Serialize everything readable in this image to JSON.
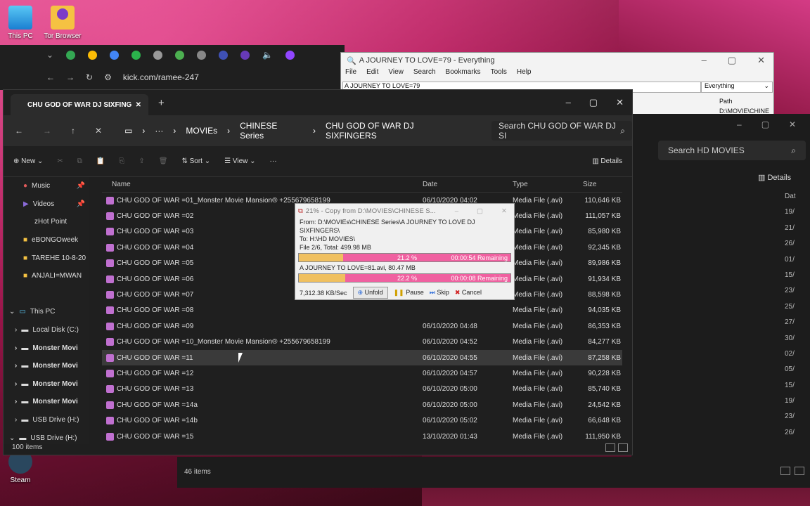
{
  "desktop": {
    "icons": [
      {
        "label": "This PC"
      },
      {
        "label": "Tor Browser"
      },
      {
        "label": "Steam"
      }
    ]
  },
  "browser": {
    "url": "kick.com/ramee-247"
  },
  "everything": {
    "title": "A JOURNEY TO LOVE=79 - Everything",
    "menu": [
      "File",
      "Edit",
      "View",
      "Search",
      "Bookmarks",
      "Tools",
      "Help"
    ],
    "search": "A JOURNEY TO LOVE=79",
    "filter": "Everything",
    "col": "Path",
    "pathval": "D:\\MOVIE\\CHINE"
  },
  "explorer2": {
    "search": "Search HD MOVIES",
    "details": "Details",
    "datcol": "Dat",
    "dates": [
      "19/",
      "21/",
      "26/",
      "01/",
      "15/",
      "23/",
      "25/",
      "27/",
      "30/",
      "02/",
      "05/",
      "15/",
      "19/",
      "23/",
      "26/"
    ],
    "items": "46 items"
  },
  "explorer": {
    "tab": "CHU GOD OF WAR DJ SIXFING",
    "crumbs": [
      "MOVIEs",
      "CHINESE Series",
      "CHU GOD OF WAR DJ SIXFINGERS"
    ],
    "search": "Search CHU GOD OF WAR DJ SI",
    "cmd": {
      "new": "New",
      "sort": "Sort",
      "view": "View",
      "details": "Details"
    },
    "nav": [
      {
        "label": "Music"
      },
      {
        "label": "Videos"
      },
      {
        "label": "zHot Point"
      },
      {
        "label": "eBONGOweek"
      },
      {
        "label": "TAREHE 10-8-20"
      },
      {
        "label": "ANJALI=MWAN"
      },
      {
        "label": ""
      },
      {
        "label": "This PC"
      },
      {
        "label": "Local Disk (C:)"
      },
      {
        "label": "Monster Movi"
      },
      {
        "label": "Monster Movi"
      },
      {
        "label": "Monster Movi"
      },
      {
        "label": "Monster Movi"
      },
      {
        "label": "USB Drive (H:)"
      },
      {
        "label": "USB Drive (H:)"
      }
    ],
    "headers": {
      "name": "Name",
      "date": "Date",
      "type": "Type",
      "size": "Size"
    },
    "rows": [
      {
        "name": "CHU GOD OF WAR =01_Monster Movie Mansion® +255679658199",
        "date": "06/10/2020 04:02",
        "type": "Media File (.avi)",
        "size": "110,646 KB"
      },
      {
        "name": "CHU GOD OF WAR =02",
        "date": "",
        "type": "Media File (.avi)",
        "size": "111,057 KB"
      },
      {
        "name": "CHU GOD OF WAR =03",
        "date": "",
        "type": "Media File (.avi)",
        "size": "85,980 KB"
      },
      {
        "name": "CHU GOD OF WAR =04",
        "date": "",
        "type": "Media File (.avi)",
        "size": "92,345 KB"
      },
      {
        "name": "CHU GOD OF WAR =05",
        "date": "",
        "type": "Media File (.avi)",
        "size": "89,986 KB"
      },
      {
        "name": "CHU GOD OF WAR =06",
        "date": "",
        "type": "Media File (.avi)",
        "size": "91,934 KB"
      },
      {
        "name": "CHU GOD OF WAR =07",
        "date": "",
        "type": "Media File (.avi)",
        "size": "88,598 KB"
      },
      {
        "name": "CHU GOD OF WAR =08",
        "date": "",
        "type": "Media File (.avi)",
        "size": "94,035 KB"
      },
      {
        "name": "CHU GOD OF WAR =09",
        "date": "06/10/2020 04:48",
        "type": "Media File (.avi)",
        "size": "86,353 KB"
      },
      {
        "name": "CHU GOD OF WAR =10_Monster Movie Mansion® +255679658199",
        "date": "06/10/2020 04:52",
        "type": "Media File (.avi)",
        "size": "84,277 KB"
      },
      {
        "name": "CHU GOD OF WAR =11",
        "date": "06/10/2020 04:55",
        "type": "Media File (.avi)",
        "size": "87,258 KB"
      },
      {
        "name": "CHU GOD OF WAR =12",
        "date": "06/10/2020 04:57",
        "type": "Media File (.avi)",
        "size": "90,228 KB"
      },
      {
        "name": "CHU GOD OF WAR =13",
        "date": "06/10/2020 05:00",
        "type": "Media File (.avi)",
        "size": "85,740 KB"
      },
      {
        "name": "CHU GOD OF WAR =14a",
        "date": "06/10/2020 05:00",
        "type": "Media File (.avi)",
        "size": "24,542 KB"
      },
      {
        "name": "CHU GOD OF WAR =14b",
        "date": "06/10/2020 05:02",
        "type": "Media File (.avi)",
        "size": "66,648 KB"
      },
      {
        "name": "CHU GOD OF WAR =15",
        "date": "13/10/2020 01:43",
        "type": "Media File (.avi)",
        "size": "111,950 KB"
      }
    ],
    "status": "100 items"
  },
  "copy": {
    "title": "21% - Copy from D:\\MOVIES\\CHINESE S...",
    "from": "From:  D:\\MOVIEs\\CHINESE Series\\A JOURNEY TO LOVE DJ SIXFINGERS\\",
    "to": "To:     H:\\HD MOVIES\\",
    "file": "File 2/6, Total: 499.98 MB",
    "bar1": {
      "progress": 0.21,
      "label": "21.2 %",
      "remaining": "00:00:54 Remaining"
    },
    "current": "A JOURNEY TO LOVE=81.avi, 80.47 MB",
    "bar2": {
      "progress": 0.22,
      "label": "22.2 %",
      "remaining": "00:00:08 Remaining"
    },
    "speed": "7,312.38 KB/Sec",
    "buttons": {
      "unfold": "Unfold",
      "pause": "Pause",
      "skip": "Skip",
      "cancel": "Cancel"
    }
  }
}
